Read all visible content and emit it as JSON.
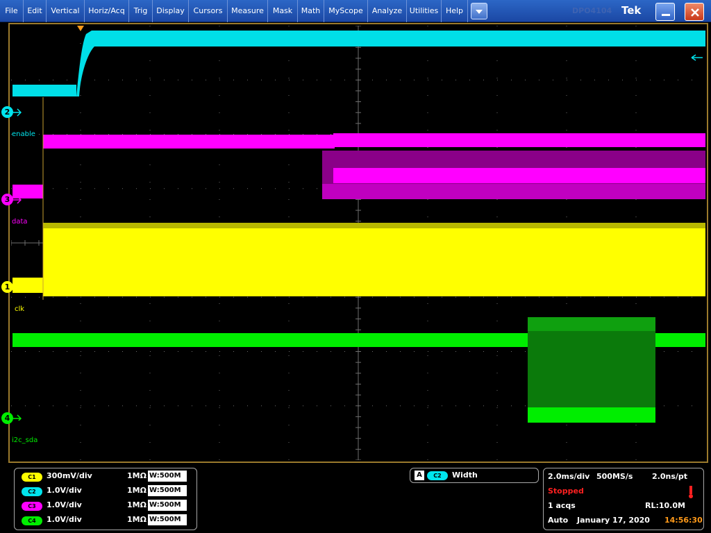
{
  "menu": {
    "items": [
      "File",
      "Edit",
      "Vertical",
      "Horiz/Acq",
      "Trig",
      "Display",
      "Cursors",
      "Measure",
      "Mask",
      "Math",
      "MyScope",
      "Analyze",
      "Utilities",
      "Help"
    ],
    "brand_ghost": "DPO4104",
    "brand": "Tek"
  },
  "channels": [
    {
      "id": "C1",
      "number": "1",
      "scale": "300mV/div",
      "impedance": "1MΩ",
      "bandwidth": "500M",
      "color": "#ffff00",
      "name": "clk"
    },
    {
      "id": "C2",
      "number": "2",
      "scale": "1.0V/div",
      "impedance": "1MΩ",
      "bandwidth": "500M",
      "color": "#00e5ee",
      "name": "enable"
    },
    {
      "id": "C3",
      "number": "3",
      "scale": "1.0V/div",
      "impedance": "1MΩ",
      "bandwidth": "500M",
      "color": "#ff00ff",
      "name": "data"
    },
    {
      "id": "C4",
      "number": "4",
      "scale": "1.0V/div",
      "impedance": "1MΩ",
      "bandwidth": "500M",
      "color": "#00ff00",
      "name": "i2c_sda"
    }
  ],
  "bandwidth_prefix": "W:",
  "measurement": {
    "slot": "A",
    "channel": "C2",
    "type": "Width"
  },
  "acquisition": {
    "timebase": "2.0ms/div",
    "sample_rate": "500MS/s",
    "resolution": "2.0ns/pt",
    "state": "Stopped",
    "acqs": "1 acqs",
    "record_length": "RL:10.0M",
    "trigger_mode": "Auto",
    "date": "January 17, 2020",
    "time": "14:56:30"
  },
  "colors": {
    "grid": "#6e6e6e",
    "frame": "#9b7a2c",
    "stopped": "#ff2020",
    "time": "#ff9a1a",
    "trigger": "#ff9a1a"
  }
}
